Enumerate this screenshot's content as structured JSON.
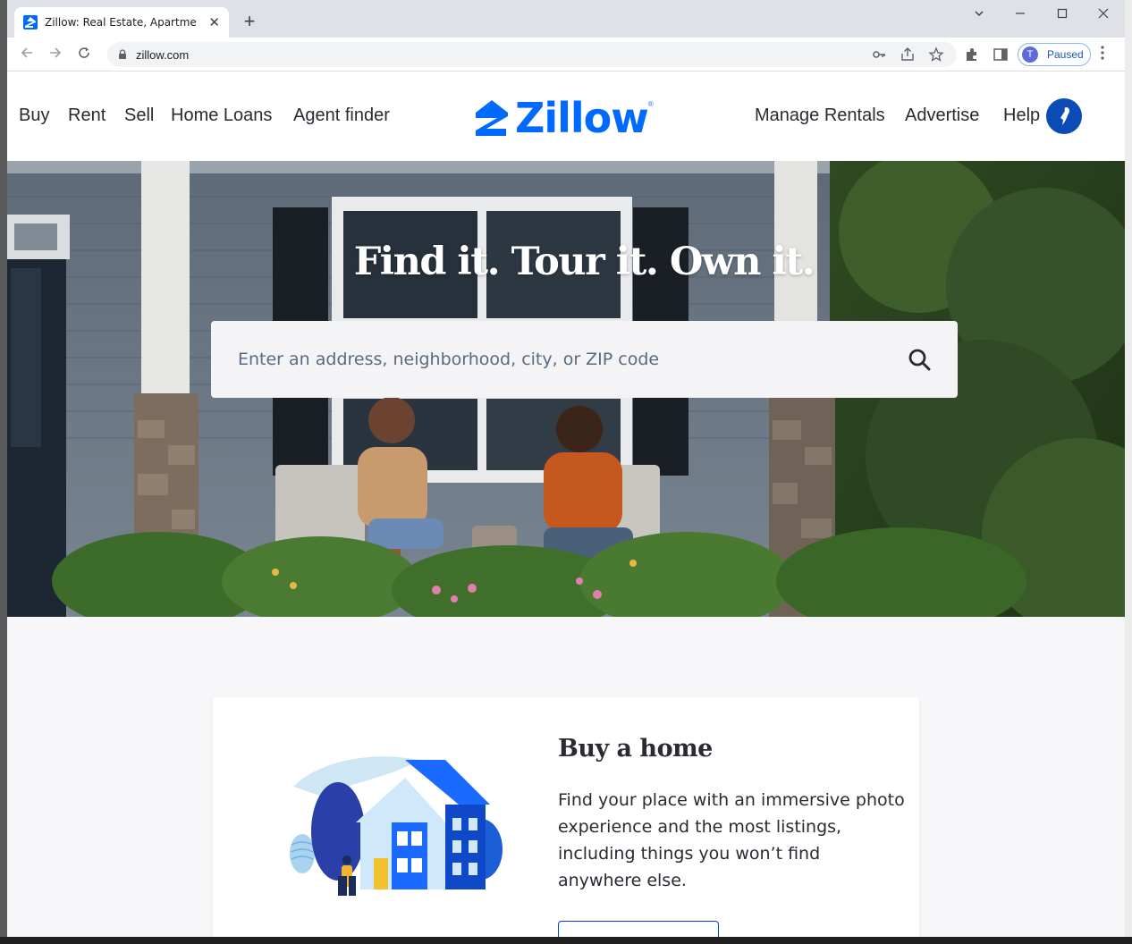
{
  "browser": {
    "tab_title": "Zillow: Real Estate, Apartments, M",
    "new_tab": "+",
    "tab_close": "✕",
    "url": "zillow.com",
    "profile_initial": "T",
    "profile_status": "Paused",
    "accent": "#1a73e8"
  },
  "site": {
    "brand": "Zillow",
    "brand_mark": "®",
    "brand_color": "#006aff",
    "nav_left": [
      "Buy",
      "Rent",
      "Sell",
      "Home Loans",
      "Agent finder"
    ],
    "nav_right": [
      "Manage Rentals",
      "Advertise",
      "Help"
    ]
  },
  "hero": {
    "title": "Find it. Tour it. Own it.",
    "search_placeholder": "Enter an address, neighborhood, city, or ZIP code"
  },
  "card": {
    "title": "Buy a home",
    "text": "Find your place with an immersive photo experience and the most listings, including things you won’t find anywhere else."
  }
}
